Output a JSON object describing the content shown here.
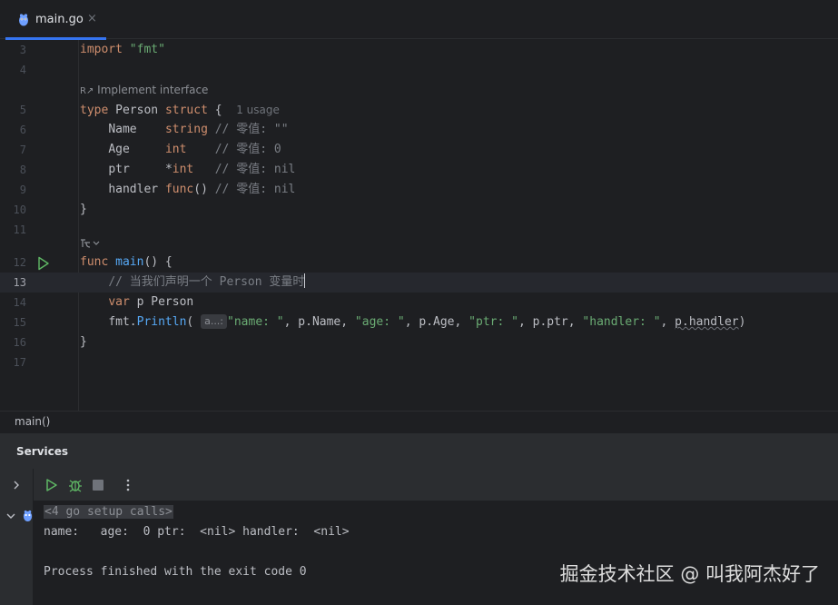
{
  "tab": {
    "label": "main.go",
    "close": "×"
  },
  "lens": {
    "implement": "Implement interface",
    "usage": "1 usage",
    "run": "▷"
  },
  "lines": [
    {
      "n": "3"
    },
    {
      "n": "4"
    },
    {
      "n": "5"
    },
    {
      "n": "6"
    },
    {
      "n": "7"
    },
    {
      "n": "8"
    },
    {
      "n": "9"
    },
    {
      "n": "10"
    },
    {
      "n": "11"
    },
    {
      "n": "12"
    },
    {
      "n": "13"
    },
    {
      "n": "14"
    },
    {
      "n": "15"
    },
    {
      "n": "16"
    },
    {
      "n": "17"
    }
  ],
  "code": {
    "import_kw": "import",
    "import_str": "\"fmt\"",
    "type_kw": "type",
    "type_name": "Person",
    "struct_kw": "struct",
    "brace_open": "{",
    "f_name": "Name",
    "f_name_type": "string",
    "f_name_cm": "// 零值: \"\"",
    "f_age": "Age",
    "f_age_type": "int",
    "f_age_cm": "// 零值: 0",
    "f_ptr": "ptr",
    "f_ptr_star": "*",
    "f_ptr_type": "int",
    "f_ptr_cm": "// 零值: nil",
    "f_handler": "handler",
    "f_handler_type": "func",
    "f_handler_parens": "()",
    "f_handler_cm": "// 零值: nil",
    "brace_close": "}",
    "func_kw": "func",
    "func_name": "main",
    "func_rest": "() {",
    "comment13": "// 当我们声明一个 Person 变量时",
    "var_kw": "var",
    "var_rest": "p Person",
    "println_pkg": "fmt.",
    "println_fn": "Println",
    "println_open": "(",
    "param_hint": "a...:",
    "arg1": "\"name: \"",
    "arg2": ", p.Name, ",
    "arg3": "\"age: \"",
    "arg4": ", p.Age, ",
    "arg5": "\"ptr: \"",
    "arg6": ", p.ptr, ",
    "arg7": "\"handler: \"",
    "arg8": ", ",
    "arg9": "p.handler",
    "println_close": ")",
    "func_close": "}"
  },
  "breadcrumb": "main()",
  "services": {
    "title": "Services",
    "console": {
      "setup": "<4 go setup calls>",
      "output": "name:   age:  0 ptr:  <nil> handler:  <nil>",
      "finished": "Process finished with the exit code 0"
    }
  },
  "watermark": "掘金技术社区 @ 叫我阿杰好了",
  "colors": {
    "accent": "#3574f0",
    "run_green": "#5fb865",
    "keyword": "#cf8e6d",
    "string": "#6aab73",
    "function": "#56a8f5"
  }
}
